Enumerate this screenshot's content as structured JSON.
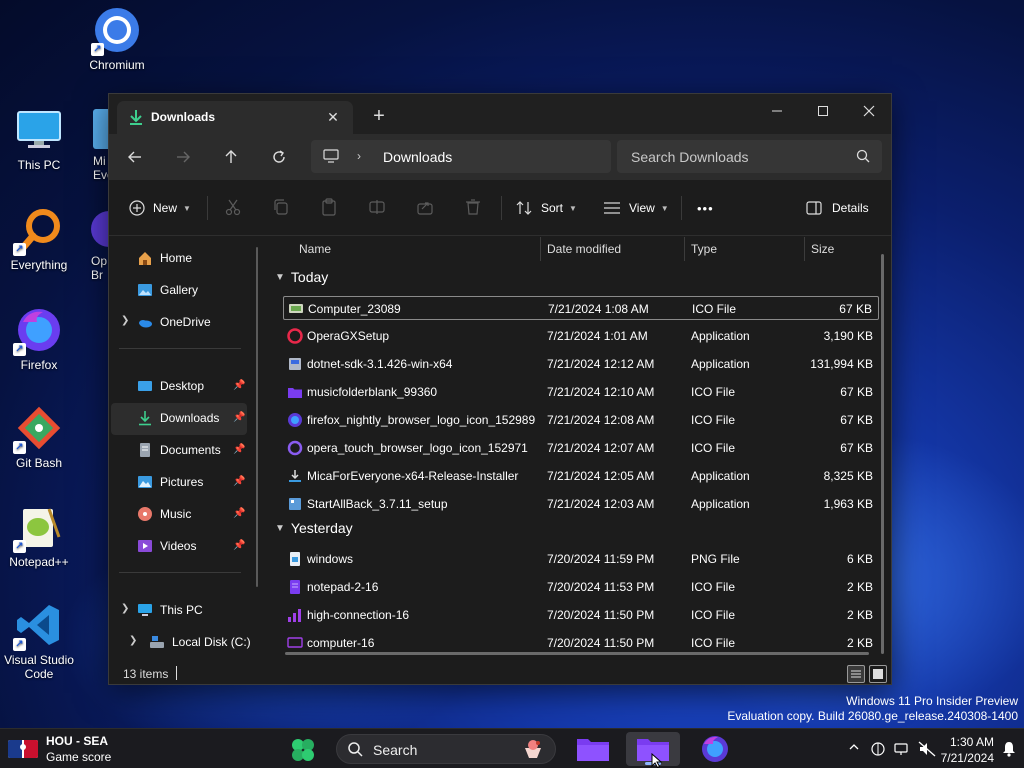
{
  "desktop": {
    "icons": [
      {
        "label": "Chromium"
      },
      {
        "label": "This PC"
      },
      {
        "label": "Mi Eve"
      },
      {
        "label": "Everything"
      },
      {
        "label": "Op Br"
      },
      {
        "label": "Firefox"
      },
      {
        "label": "Git Bash"
      },
      {
        "label": "Notepad++"
      },
      {
        "label": "Visual Studio Code"
      }
    ]
  },
  "window": {
    "tab_label": "Downloads",
    "address_segment": "Downloads",
    "search_placeholder": "Search Downloads",
    "toolbar": {
      "new_label": "New",
      "sort_label": "Sort",
      "view_label": "View",
      "more_label": "•••",
      "details_label": "Details"
    },
    "sidebar": {
      "items": [
        {
          "label": "Home"
        },
        {
          "label": "Gallery"
        },
        {
          "label": "OneDrive"
        },
        {
          "label": "Desktop"
        },
        {
          "label": "Downloads"
        },
        {
          "label": "Documents"
        },
        {
          "label": "Pictures"
        },
        {
          "label": "Music"
        },
        {
          "label": "Videos"
        },
        {
          "label": "This PC"
        },
        {
          "label": "Local Disk (C:)"
        }
      ]
    },
    "columns": {
      "name": "Name",
      "date": "Date modified",
      "type": "Type",
      "size": "Size"
    },
    "groups": {
      "today": "Today",
      "yesterday": "Yesterday"
    },
    "files_today": [
      {
        "name": "Computer_23089",
        "date": "7/21/2024 1:08 AM",
        "type": "ICO File",
        "size": "67 KB"
      },
      {
        "name": "OperaGXSetup",
        "date": "7/21/2024 1:01 AM",
        "type": "Application",
        "size": "3,190 KB"
      },
      {
        "name": "dotnet-sdk-3.1.426-win-x64",
        "date": "7/21/2024 12:12 AM",
        "type": "Application",
        "size": "131,994 KB"
      },
      {
        "name": "musicfolderblank_99360",
        "date": "7/21/2024 12:10 AM",
        "type": "ICO File",
        "size": "67 KB"
      },
      {
        "name": "firefox_nightly_browser_logo_icon_152989",
        "date": "7/21/2024 12:08 AM",
        "type": "ICO File",
        "size": "67 KB"
      },
      {
        "name": "opera_touch_browser_logo_icon_152971",
        "date": "7/21/2024 12:07 AM",
        "type": "ICO File",
        "size": "67 KB"
      },
      {
        "name": "MicaForEveryone-x64-Release-Installer",
        "date": "7/21/2024 12:05 AM",
        "type": "Application",
        "size": "8,325 KB"
      },
      {
        "name": "StartAllBack_3.7.11_setup",
        "date": "7/21/2024 12:03 AM",
        "type": "Application",
        "size": "1,963 KB"
      }
    ],
    "files_yesterday": [
      {
        "name": "windows",
        "date": "7/20/2024 11:59 PM",
        "type": "PNG File",
        "size": "6 KB"
      },
      {
        "name": "notepad-2-16",
        "date": "7/20/2024 11:53 PM",
        "type": "ICO File",
        "size": "2 KB"
      },
      {
        "name": "high-connection-16",
        "date": "7/20/2024 11:50 PM",
        "type": "ICO File",
        "size": "2 KB"
      },
      {
        "name": "computer-16",
        "date": "7/20/2024 11:50 PM",
        "type": "ICO File",
        "size": "2 KB"
      }
    ],
    "status_count": "13 items"
  },
  "watermark": {
    "line1": "Windows 11 Pro Insider Preview",
    "line2": "Evaluation copy. Build 26080.ge_release.240308-1400"
  },
  "taskbar": {
    "widget_title": "HOU - SEA",
    "widget_sub": "Game score",
    "search_label": "Search",
    "time": "1:30 AM",
    "date": "7/21/2024"
  },
  "colors": {
    "accent_green": "#3ecf8e",
    "folder_purple": "#7a3cf0",
    "selection": "#2d2d2d"
  }
}
